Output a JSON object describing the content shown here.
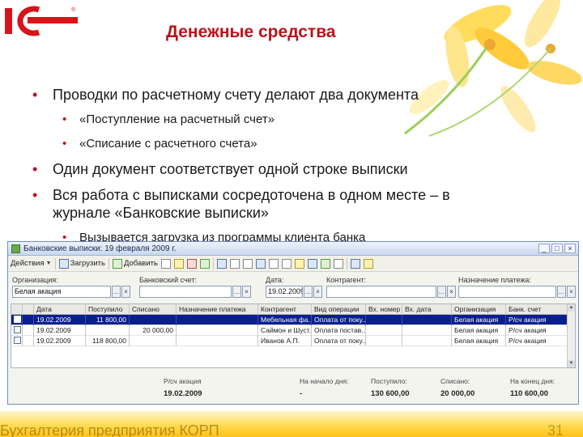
{
  "slide": {
    "title": "Денежные средства",
    "bullets": [
      {
        "level": 1,
        "text": "Проводки по расчетному счету делают два документа"
      },
      {
        "level": 2,
        "text": "«Поступление на расчетный счет»"
      },
      {
        "level": 2,
        "text": "«Списание с расчетного счета»"
      },
      {
        "level": 1,
        "text": "Один документ соответствует одной строке выписки"
      },
      {
        "level": 1,
        "text": "Вся работа с выписками сосредоточена в одном месте – в журнале «Банковские выписки»"
      },
      {
        "level": 2,
        "text": "Вызывается загрузка из программы клиента банка"
      }
    ],
    "footer": "Бухгалтерия предприятия КОРП",
    "page_number": "31",
    "colors": {
      "title": "#b8141b",
      "bullet": "#c0141b",
      "logo": "#d7141b"
    }
  },
  "window": {
    "title": "Банковские выписки: 19 февраля 2009 г.",
    "toolbar": {
      "actions_label": "Действия",
      "load_label": "Загрузить",
      "add_label": "Добавить"
    },
    "filters": {
      "org_label": "Организация:",
      "org_value": "Белая акация",
      "bank_label": "Банковский счет:",
      "bank_value": "",
      "date_label": "Дата:",
      "date_value": "19.02.2009",
      "contractor_label": "Контрагент:",
      "contractor_value": "",
      "purpose_label": "Назначение платежа:",
      "purpose_value": ""
    },
    "table": {
      "headers": [
        "Дата",
        "Поступило",
        "Списано",
        "Назначение платежа",
        "Контрагент",
        "Вид операции",
        "Вх. номер",
        "Вх. дата",
        "Организация",
        "Банк. счет"
      ],
      "rows": [
        {
          "date": "19.02.2009",
          "income": "11 800,00",
          "expense": "",
          "purpose": "",
          "contractor": "Мебельная фа...",
          "operation": "Оплата от поку...",
          "in_number": "",
          "in_date": "",
          "org": "Белая акация",
          "account": "Р/сч акация",
          "selected": true
        },
        {
          "date": "19.02.2009",
          "income": "",
          "expense": "20 000,00",
          "purpose": "",
          "contractor": "Саймон и Шуст...",
          "operation": "Оплата постав...",
          "in_number": "",
          "in_date": "",
          "org": "Белая акация",
          "account": "Р/сч акация",
          "selected": false
        },
        {
          "date": "19.02.2009",
          "income": "118 800,00",
          "expense": "",
          "purpose": "",
          "contractor": "Иванов А.П.",
          "operation": "Оплата от поку...",
          "in_number": "",
          "in_date": "",
          "org": "Белая акация",
          "account": "Р/сч акация",
          "selected": false
        }
      ]
    },
    "summary": {
      "account_label": "Р/сч акация",
      "account_date": "19.02.2009",
      "start_label": "На начало дня:",
      "start_value": "-",
      "income_label": "Поступило:",
      "income_value": "130 600,00",
      "expense_label": "Списано:",
      "expense_value": "20 000,00",
      "end_label": "На конец дня:",
      "end_value": "110 600,00"
    }
  }
}
